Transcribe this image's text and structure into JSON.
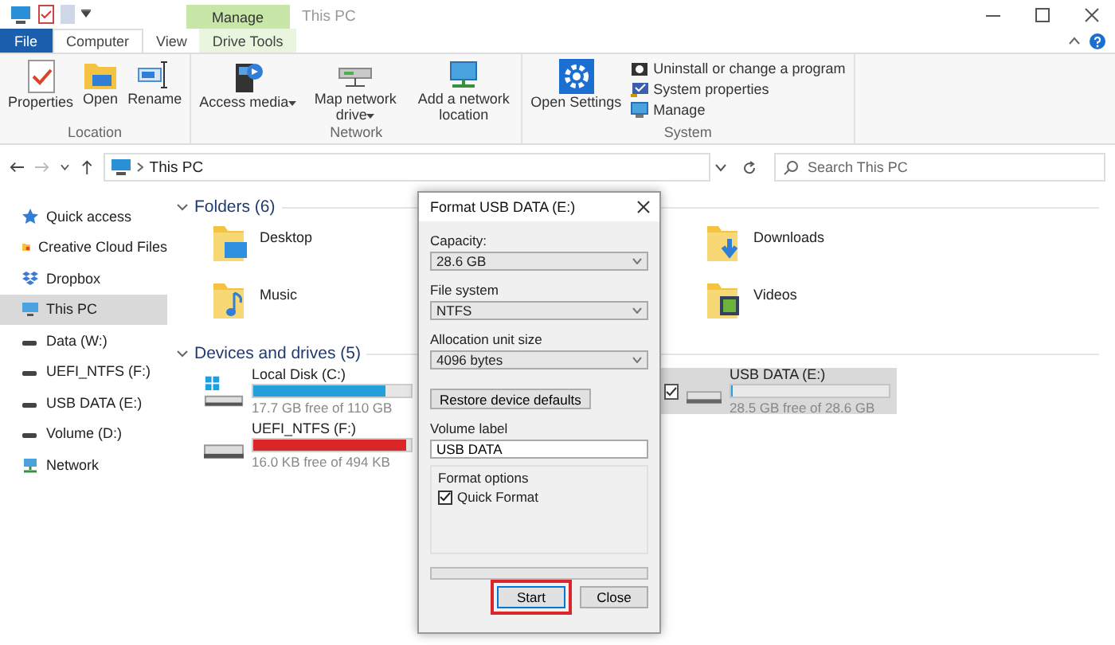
{
  "window": {
    "title": "This PC",
    "contextual_tab": "Manage"
  },
  "ribbon_tabs": [
    {
      "label": "File",
      "selected": false,
      "kind": "file"
    },
    {
      "label": "Computer",
      "selected": true,
      "kind": "tab"
    },
    {
      "label": "View",
      "selected": false,
      "kind": "tab"
    },
    {
      "label": "Drive Tools",
      "selected": false,
      "kind": "contextual"
    }
  ],
  "ribbon_groups": [
    {
      "label": "Location",
      "commands": [
        {
          "label": "Properties",
          "kind": "properties",
          "dropdown": false
        },
        {
          "label": "Open",
          "kind": "open",
          "dropdown": false
        },
        {
          "label": "Rename",
          "kind": "rename",
          "dropdown": false
        }
      ]
    },
    {
      "label": "Network",
      "commands": [
        {
          "label": "Access media",
          "kind": "media",
          "dropdown": true
        },
        {
          "label": "Map network drive",
          "kind": "mapdrive",
          "dropdown": true
        },
        {
          "label": "Add a network location",
          "kind": "netloc",
          "dropdown": false
        }
      ]
    },
    {
      "label": "System",
      "commands": [
        {
          "label": "Open Settings",
          "kind": "settings",
          "dropdown": false
        }
      ],
      "small_commands": [
        {
          "label": "Uninstall or change a program",
          "kind": "uninstall"
        },
        {
          "label": "System properties",
          "kind": "sysprops"
        },
        {
          "label": "Manage",
          "kind": "manage"
        }
      ]
    }
  ],
  "address": {
    "path": "This PC"
  },
  "search": {
    "placeholder": "Search This PC"
  },
  "nav_items": [
    {
      "label": "Quick access",
      "kind": "star",
      "selected": false
    },
    {
      "label": "Creative Cloud Files",
      "kind": "cloud",
      "selected": false
    },
    {
      "label": "Dropbox",
      "kind": "dropbox",
      "selected": false
    },
    {
      "label": "This PC",
      "kind": "pc",
      "selected": true
    },
    {
      "label": "Data (W:)",
      "kind": "drive",
      "selected": false
    },
    {
      "label": "UEFI_NTFS (F:)",
      "kind": "drive",
      "selected": false
    },
    {
      "label": "USB DATA (E:)",
      "kind": "drive",
      "selected": false
    },
    {
      "label": "Volume (D:)",
      "kind": "drive",
      "selected": false
    },
    {
      "label": "Network",
      "kind": "network",
      "selected": false
    }
  ],
  "folders": {
    "title": "Folders (6)",
    "expanded": true,
    "items": [
      {
        "label": "Desktop",
        "kind": "desktop"
      },
      {
        "label": "Downloads",
        "kind": "downloads"
      },
      {
        "label": "Music",
        "kind": "music"
      },
      {
        "label": "Videos",
        "kind": "videos"
      }
    ]
  },
  "drives": {
    "title": "Devices and drives (5)",
    "expanded": true,
    "items": [
      {
        "name": "Local Disk (C:)",
        "free": "17.7 GB free of 110 GB",
        "level": 0.84,
        "low_space": false,
        "selected": false,
        "kind": "system"
      },
      {
        "name": "USB DATA (E:)",
        "free": "28.5 GB free of 28.6 GB",
        "level": 0.01,
        "low_space": false,
        "selected": true,
        "kind": "usb"
      },
      {
        "name": "UEFI_NTFS (F:)",
        "free": "16.0 KB free of 494 KB",
        "level": 0.97,
        "low_space": true,
        "selected": false,
        "kind": "disk"
      }
    ]
  },
  "dialog": {
    "title": "Format USB DATA (E:)",
    "fields": [
      {
        "label": "Capacity:",
        "value": "28.6 GB"
      },
      {
        "label": "File system",
        "value": "NTFS"
      },
      {
        "label": "Allocation unit size",
        "value": "4096 bytes"
      }
    ],
    "restore_button": "Restore device defaults",
    "volume_label": {
      "label": "Volume label",
      "value": "USB DATA"
    },
    "format_options": {
      "title": "Format options",
      "quick_format": {
        "label": "Quick Format",
        "checked": true
      }
    },
    "progress": {
      "level": 0
    },
    "buttons": [
      {
        "label": "Start",
        "default": true,
        "highlighted": true
      },
      {
        "label": "Close",
        "default": false,
        "highlighted": false
      }
    ]
  }
}
